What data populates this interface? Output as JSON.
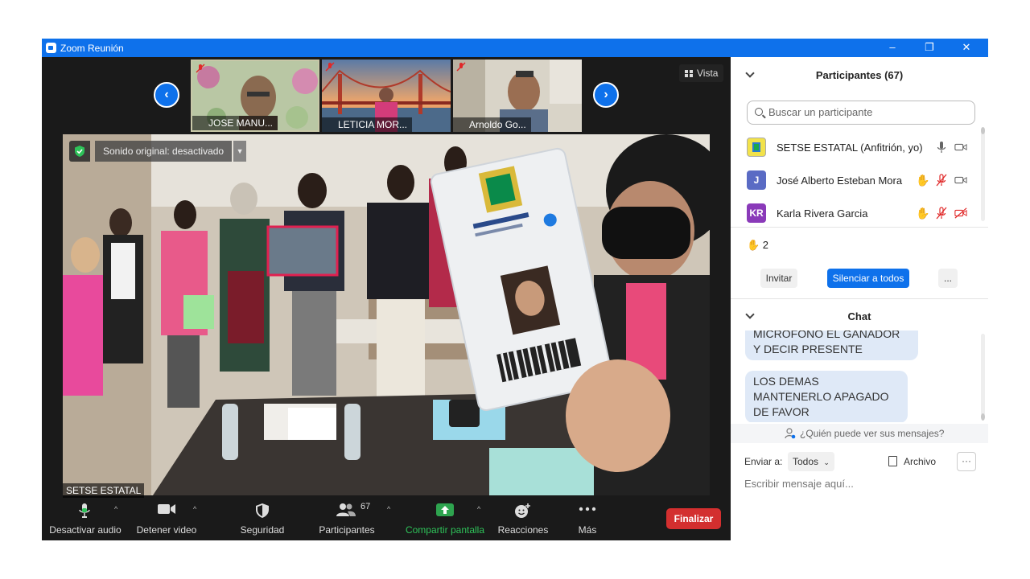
{
  "window": {
    "title": "Zoom Reunión",
    "controls": [
      "–",
      "❐",
      "✕"
    ]
  },
  "gallery": {
    "thumbnails": [
      {
        "name": "JOSE MANU...",
        "muted": true
      },
      {
        "name": "LETICIA MOR...",
        "muted": true
      },
      {
        "name": "Arnoldo Go...",
        "muted": true
      }
    ],
    "prev": "‹",
    "next": "›",
    "view_label": "Vista"
  },
  "main_video": {
    "original_sound": "Sonido original: desactivado",
    "speaker_name": "SETSE ESTATAL"
  },
  "toolbar": {
    "mute_audio": "Desactivar audio",
    "stop_video": "Detener video",
    "security": "Seguridad",
    "participants": "Participantes",
    "participants_count": "67",
    "share_screen": "Compartir pantalla",
    "reactions": "Reacciones",
    "more": "Más",
    "end": "Finalizar",
    "share_color": "#2ea44f",
    "end_color": "#d32f2f"
  },
  "participants_panel": {
    "title": "Participantes (67)",
    "search_placeholder": "Buscar un participante",
    "items": [
      {
        "name": "SETSE ESTATAL (Anfitrión, yo)",
        "avatar": "",
        "avatar_color": "#f2e24a",
        "hand": false,
        "mic": "on",
        "video": "on"
      },
      {
        "name": "José Alberto Esteban Mora",
        "avatar": "J",
        "avatar_color": "#5a6bc4",
        "hand": true,
        "mic": "muted",
        "video": "on"
      },
      {
        "name": "Karla Rivera Garcia",
        "avatar": "KR",
        "avatar_color": "#8a3ab9",
        "hand": true,
        "mic": "muted",
        "video": "off"
      }
    ],
    "raised_hands": "✋ 2",
    "invite": "Invitar",
    "mute_all": "Silenciar a todos",
    "more": "..."
  },
  "chat": {
    "title": "Chat",
    "messages": [
      "MICROFONO EL GANADOR Y DECIR PRESENTE",
      "LOS DEMAS MANTENERLO APAGADO DE FAVOR"
    ],
    "who_can_see": "¿Quién puede ver sus mensajes?",
    "send_to_label": "Enviar a:",
    "send_to_value": "Todos",
    "file_label": "Archivo",
    "more": "···",
    "input_placeholder": "Escribir mensaje aquí..."
  },
  "accent_color": "#0e71eb"
}
